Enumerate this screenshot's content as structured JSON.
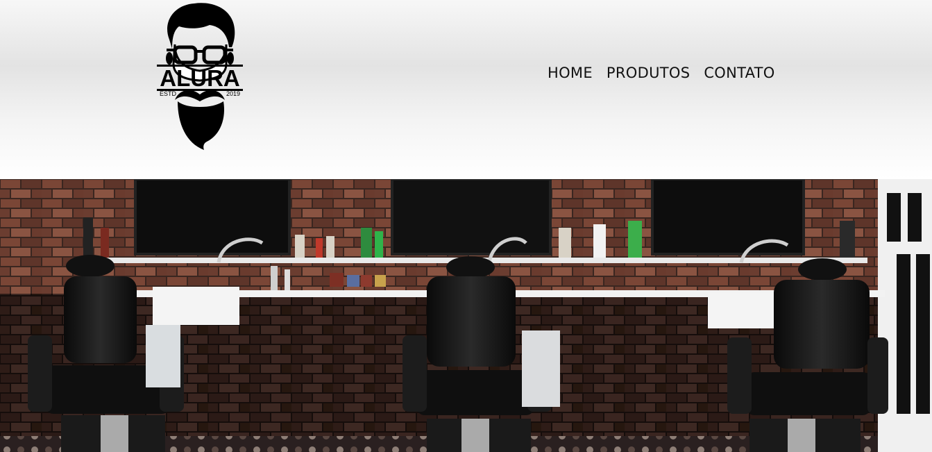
{
  "logo": {
    "name": "ALURA",
    "estd_label": "ESTD",
    "year": "2019"
  },
  "nav": {
    "items": [
      {
        "label": "HOME"
      },
      {
        "label": "PRODUTOS"
      },
      {
        "label": "CONTATO"
      }
    ]
  },
  "banner": {
    "subject": "barbershop-interior-photo"
  },
  "colors": {
    "text": "#111111",
    "logo": "#000000",
    "header_bg": "#e8e8e8"
  }
}
